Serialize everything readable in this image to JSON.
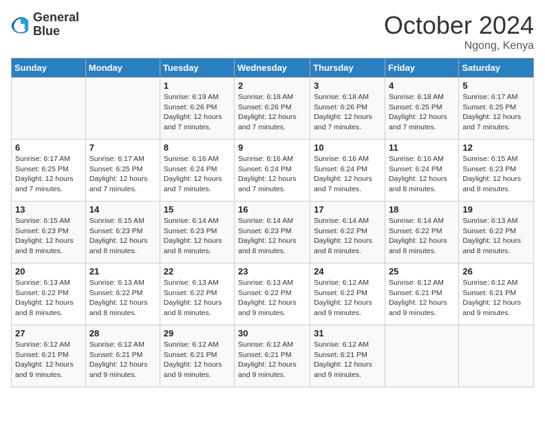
{
  "header": {
    "logo_line1": "General",
    "logo_line2": "Blue",
    "month": "October 2024",
    "location": "Ngong, Kenya"
  },
  "days_of_week": [
    "Sunday",
    "Monday",
    "Tuesday",
    "Wednesday",
    "Thursday",
    "Friday",
    "Saturday"
  ],
  "weeks": [
    [
      {
        "day": "",
        "info": ""
      },
      {
        "day": "",
        "info": ""
      },
      {
        "day": "1",
        "info": "Sunrise: 6:19 AM\nSunset: 6:26 PM\nDaylight: 12 hours\nand 7 minutes."
      },
      {
        "day": "2",
        "info": "Sunrise: 6:18 AM\nSunset: 6:26 PM\nDaylight: 12 hours\nand 7 minutes."
      },
      {
        "day": "3",
        "info": "Sunrise: 6:18 AM\nSunset: 6:26 PM\nDaylight: 12 hours\nand 7 minutes."
      },
      {
        "day": "4",
        "info": "Sunrise: 6:18 AM\nSunset: 6:25 PM\nDaylight: 12 hours\nand 7 minutes."
      },
      {
        "day": "5",
        "info": "Sunrise: 6:17 AM\nSunset: 6:25 PM\nDaylight: 12 hours\nand 7 minutes."
      }
    ],
    [
      {
        "day": "6",
        "info": "Sunrise: 6:17 AM\nSunset: 6:25 PM\nDaylight: 12 hours\nand 7 minutes."
      },
      {
        "day": "7",
        "info": "Sunrise: 6:17 AM\nSunset: 6:25 PM\nDaylight: 12 hours\nand 7 minutes."
      },
      {
        "day": "8",
        "info": "Sunrise: 6:16 AM\nSunset: 6:24 PM\nDaylight: 12 hours\nand 7 minutes."
      },
      {
        "day": "9",
        "info": "Sunrise: 6:16 AM\nSunset: 6:24 PM\nDaylight: 12 hours\nand 7 minutes."
      },
      {
        "day": "10",
        "info": "Sunrise: 6:16 AM\nSunset: 6:24 PM\nDaylight: 12 hours\nand 7 minutes."
      },
      {
        "day": "11",
        "info": "Sunrise: 6:16 AM\nSunset: 6:24 PM\nDaylight: 12 hours\nand 8 minutes."
      },
      {
        "day": "12",
        "info": "Sunrise: 6:15 AM\nSunset: 6:23 PM\nDaylight: 12 hours\nand 8 minutes."
      }
    ],
    [
      {
        "day": "13",
        "info": "Sunrise: 6:15 AM\nSunset: 6:23 PM\nDaylight: 12 hours\nand 8 minutes."
      },
      {
        "day": "14",
        "info": "Sunrise: 6:15 AM\nSunset: 6:23 PM\nDaylight: 12 hours\nand 8 minutes."
      },
      {
        "day": "15",
        "info": "Sunrise: 6:14 AM\nSunset: 6:23 PM\nDaylight: 12 hours\nand 8 minutes."
      },
      {
        "day": "16",
        "info": "Sunrise: 6:14 AM\nSunset: 6:23 PM\nDaylight: 12 hours\nand 8 minutes."
      },
      {
        "day": "17",
        "info": "Sunrise: 6:14 AM\nSunset: 6:22 PM\nDaylight: 12 hours\nand 8 minutes."
      },
      {
        "day": "18",
        "info": "Sunrise: 6:14 AM\nSunset: 6:22 PM\nDaylight: 12 hours\nand 8 minutes."
      },
      {
        "day": "19",
        "info": "Sunrise: 6:13 AM\nSunset: 6:22 PM\nDaylight: 12 hours\nand 8 minutes."
      }
    ],
    [
      {
        "day": "20",
        "info": "Sunrise: 6:13 AM\nSunset: 6:22 PM\nDaylight: 12 hours\nand 8 minutes."
      },
      {
        "day": "21",
        "info": "Sunrise: 6:13 AM\nSunset: 6:22 PM\nDaylight: 12 hours\nand 8 minutes."
      },
      {
        "day": "22",
        "info": "Sunrise: 6:13 AM\nSunset: 6:22 PM\nDaylight: 12 hours\nand 8 minutes."
      },
      {
        "day": "23",
        "info": "Sunrise: 6:13 AM\nSunset: 6:22 PM\nDaylight: 12 hours\nand 9 minutes."
      },
      {
        "day": "24",
        "info": "Sunrise: 6:12 AM\nSunset: 6:22 PM\nDaylight: 12 hours\nand 9 minutes."
      },
      {
        "day": "25",
        "info": "Sunrise: 6:12 AM\nSunset: 6:21 PM\nDaylight: 12 hours\nand 9 minutes."
      },
      {
        "day": "26",
        "info": "Sunrise: 6:12 AM\nSunset: 6:21 PM\nDaylight: 12 hours\nand 9 minutes."
      }
    ],
    [
      {
        "day": "27",
        "info": "Sunrise: 6:12 AM\nSunset: 6:21 PM\nDaylight: 12 hours\nand 9 minutes."
      },
      {
        "day": "28",
        "info": "Sunrise: 6:12 AM\nSunset: 6:21 PM\nDaylight: 12 hours\nand 9 minutes."
      },
      {
        "day": "29",
        "info": "Sunrise: 6:12 AM\nSunset: 6:21 PM\nDaylight: 12 hours\nand 9 minutes."
      },
      {
        "day": "30",
        "info": "Sunrise: 6:12 AM\nSunset: 6:21 PM\nDaylight: 12 hours\nand 9 minutes."
      },
      {
        "day": "31",
        "info": "Sunrise: 6:12 AM\nSunset: 6:21 PM\nDaylight: 12 hours\nand 9 minutes."
      },
      {
        "day": "",
        "info": ""
      },
      {
        "day": "",
        "info": ""
      }
    ]
  ]
}
